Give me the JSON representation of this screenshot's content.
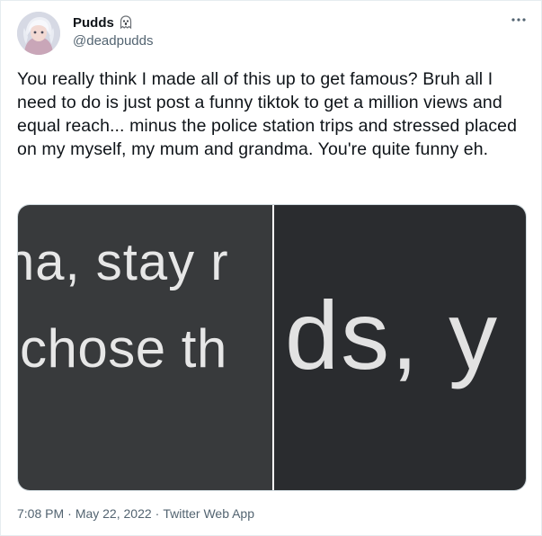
{
  "author": {
    "display_name": "Pudds",
    "handle": "@deadpudds",
    "badge_icon": "ghost-icon"
  },
  "tweet": {
    "text": "You really think I made all of this up to get famous? Bruh all I need to do is just post a funny tiktok to get a million views and equal reach... minus the police station trips and stressed placed on my myself, my mum and grandma. You're quite funny eh."
  },
  "media": {
    "left_image": {
      "line1": "na, stay r",
      "line2": "chose th"
    },
    "right_image": {
      "line1": "ds, y"
    }
  },
  "meta": {
    "time": "7:08 PM",
    "separator": "·",
    "date": "May 22, 2022",
    "source": "Twitter Web App"
  },
  "colors": {
    "text_primary": "#0f1419",
    "text_secondary": "#536471",
    "image_dark_left": "#383a3c",
    "image_dark_right": "#2a2c2f"
  }
}
